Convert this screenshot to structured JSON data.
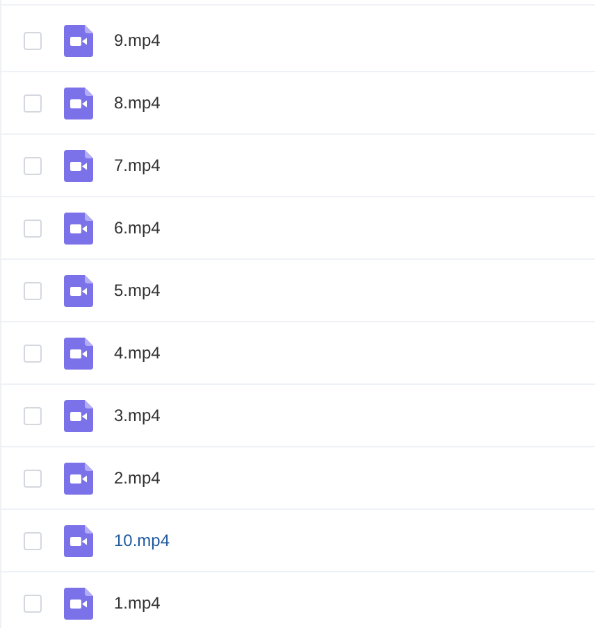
{
  "files": [
    {
      "name": "9.mp4",
      "checked": false,
      "hovered": false
    },
    {
      "name": "8.mp4",
      "checked": false,
      "hovered": false
    },
    {
      "name": "7.mp4",
      "checked": false,
      "hovered": false
    },
    {
      "name": "6.mp4",
      "checked": false,
      "hovered": false
    },
    {
      "name": "5.mp4",
      "checked": false,
      "hovered": false
    },
    {
      "name": "4.mp4",
      "checked": false,
      "hovered": false
    },
    {
      "name": "3.mp4",
      "checked": false,
      "hovered": false
    },
    {
      "name": "2.mp4",
      "checked": false,
      "hovered": false
    },
    {
      "name": "10.mp4",
      "checked": false,
      "hovered": true
    },
    {
      "name": "1.mp4",
      "checked": false,
      "hovered": false
    }
  ]
}
